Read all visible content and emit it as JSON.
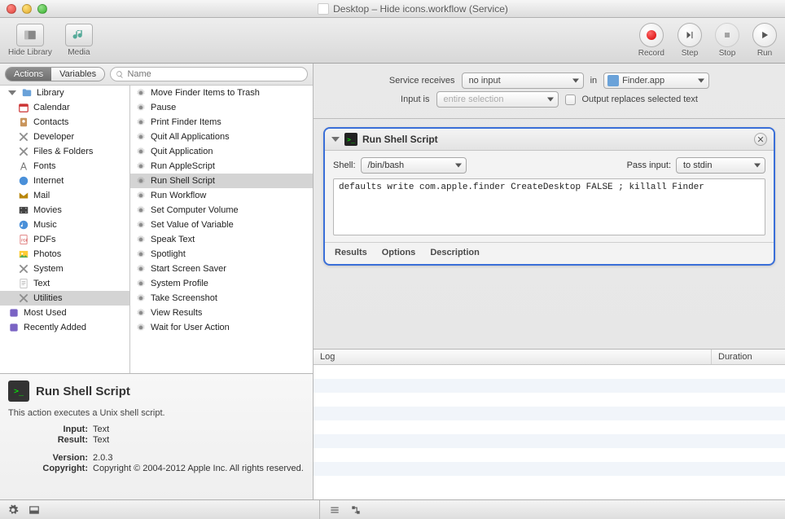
{
  "window": {
    "title": "Desktop – Hide icons.workflow (Service)"
  },
  "toolbar": {
    "hide_library": "Hide Library",
    "media": "Media",
    "record": "Record",
    "step": "Step",
    "stop": "Stop",
    "run": "Run"
  },
  "left": {
    "tabs": {
      "actions": "Actions",
      "variables": "Variables"
    },
    "search_placeholder": "Name",
    "library": {
      "root": "Library",
      "items": [
        "Calendar",
        "Contacts",
        "Developer",
        "Files & Folders",
        "Fonts",
        "Internet",
        "Mail",
        "Movies",
        "Music",
        "PDFs",
        "Photos",
        "System",
        "Text",
        "Utilities"
      ],
      "selected": "Utilities",
      "extras": [
        "Most Used",
        "Recently Added"
      ]
    },
    "actions": [
      "Move Finder Items to Trash",
      "Pause",
      "Print Finder Items",
      "Quit All Applications",
      "Quit Application",
      "Run AppleScript",
      "Run Shell Script",
      "Run Workflow",
      "Set Computer Volume",
      "Set Value of Variable",
      "Speak Text",
      "Spotlight",
      "Start Screen Saver",
      "System Profile",
      "Take Screenshot",
      "View Results",
      "Wait for User Action"
    ],
    "actions_selected": "Run Shell Script",
    "info": {
      "title": "Run Shell Script",
      "desc": "This action executes a Unix shell script.",
      "rows": [
        {
          "k": "Input:",
          "v": "Text"
        },
        {
          "k": "Result:",
          "v": "Text"
        },
        {
          "k": "Version:",
          "v": "2.0.3"
        },
        {
          "k": "Copyright:",
          "v": "Copyright © 2004-2012 Apple Inc.  All rights reserved."
        }
      ]
    }
  },
  "service": {
    "receives_label": "Service receives",
    "receives_value": "no input",
    "in_label": "in",
    "in_value": "Finder.app",
    "input_is_label": "Input is",
    "input_is_value": "entire selection",
    "output_replaces": "Output replaces selected text"
  },
  "card": {
    "title": "Run Shell Script",
    "shell_label": "Shell:",
    "shell_value": "/bin/bash",
    "pass_label": "Pass input:",
    "pass_value": "to stdin",
    "script": "defaults write com.apple.finder CreateDesktop FALSE ; killall Finder",
    "footer": {
      "results": "Results",
      "options": "Options",
      "description": "Description"
    }
  },
  "log": {
    "col1": "Log",
    "col2": "Duration"
  }
}
